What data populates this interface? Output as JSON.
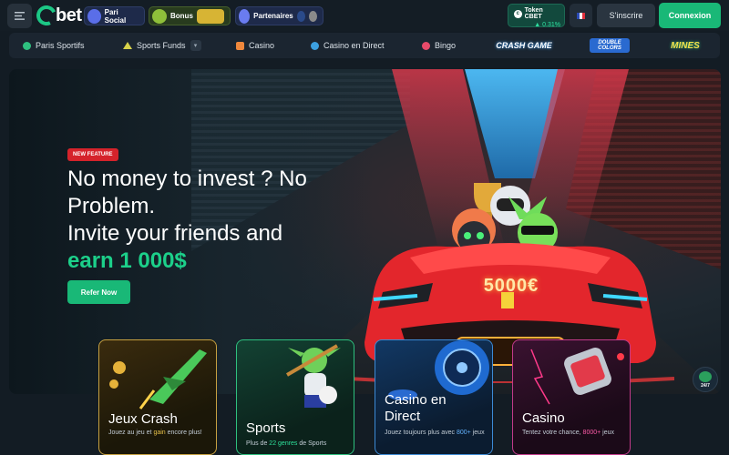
{
  "header": {
    "logo_text": "bet",
    "promos": [
      {
        "label": "Pari Social",
        "color": "#5a6ee8"
      },
      {
        "label": "Bonus",
        "color": "#d7b434"
      },
      {
        "label": "Partenaires",
        "color": "#6a7cf0"
      }
    ],
    "token": {
      "name": "Token CBET",
      "change": "▲ 0.31%"
    },
    "signup_label": "S'inscrire",
    "login_label": "Connexion"
  },
  "nav": {
    "items": [
      {
        "label": "Paris Sportifs",
        "icon": "ball-icon",
        "color": "#2ec07f"
      },
      {
        "label": "Sports Funds",
        "icon": "trend-icon",
        "color": "#d7d24a",
        "has_dropdown": true
      },
      {
        "label": "Casino",
        "icon": "cherry-icon",
        "color": "#f0883c"
      },
      {
        "label": "Casino en Direct",
        "icon": "chip-icon",
        "color": "#3ca0e0"
      },
      {
        "label": "Bingo",
        "icon": "bingo-icon",
        "color": "#e84a6a"
      }
    ],
    "game_logos": [
      "CRASH GAME",
      "DOUBLE COLORS",
      "MINES"
    ]
  },
  "hero": {
    "badge": "NEW FEATURE",
    "title_line1": "No money to invest ? No",
    "title_line2": "Problem.",
    "title_line3": "Invite your friends and",
    "title_highlight": "earn 1 000$",
    "cta_label": "Refer Now",
    "plate": "5000€"
  },
  "support": {
    "label": "24/7"
  },
  "cards": [
    {
      "title": "Jeux Crash",
      "desc_pre": "Jouez au jeu et ",
      "desc_acc": "gain",
      "desc_post": " encore plus!"
    },
    {
      "title": "Sports",
      "desc_pre": "Plus de ",
      "desc_acc": "22 genres",
      "desc_post": " de Sports"
    },
    {
      "title_line1": "Casino en",
      "title_line2": "Direct",
      "desc_pre": "Jouez toujours plus avec ",
      "desc_acc": "800+",
      "desc_post": " jeux"
    },
    {
      "title": "Casino",
      "desc_pre": "Tentez votre chance, ",
      "desc_acc": "8000+",
      "desc_post": " jeux"
    }
  ],
  "colors": {
    "accent": "#19b877",
    "background": "#131c24"
  }
}
